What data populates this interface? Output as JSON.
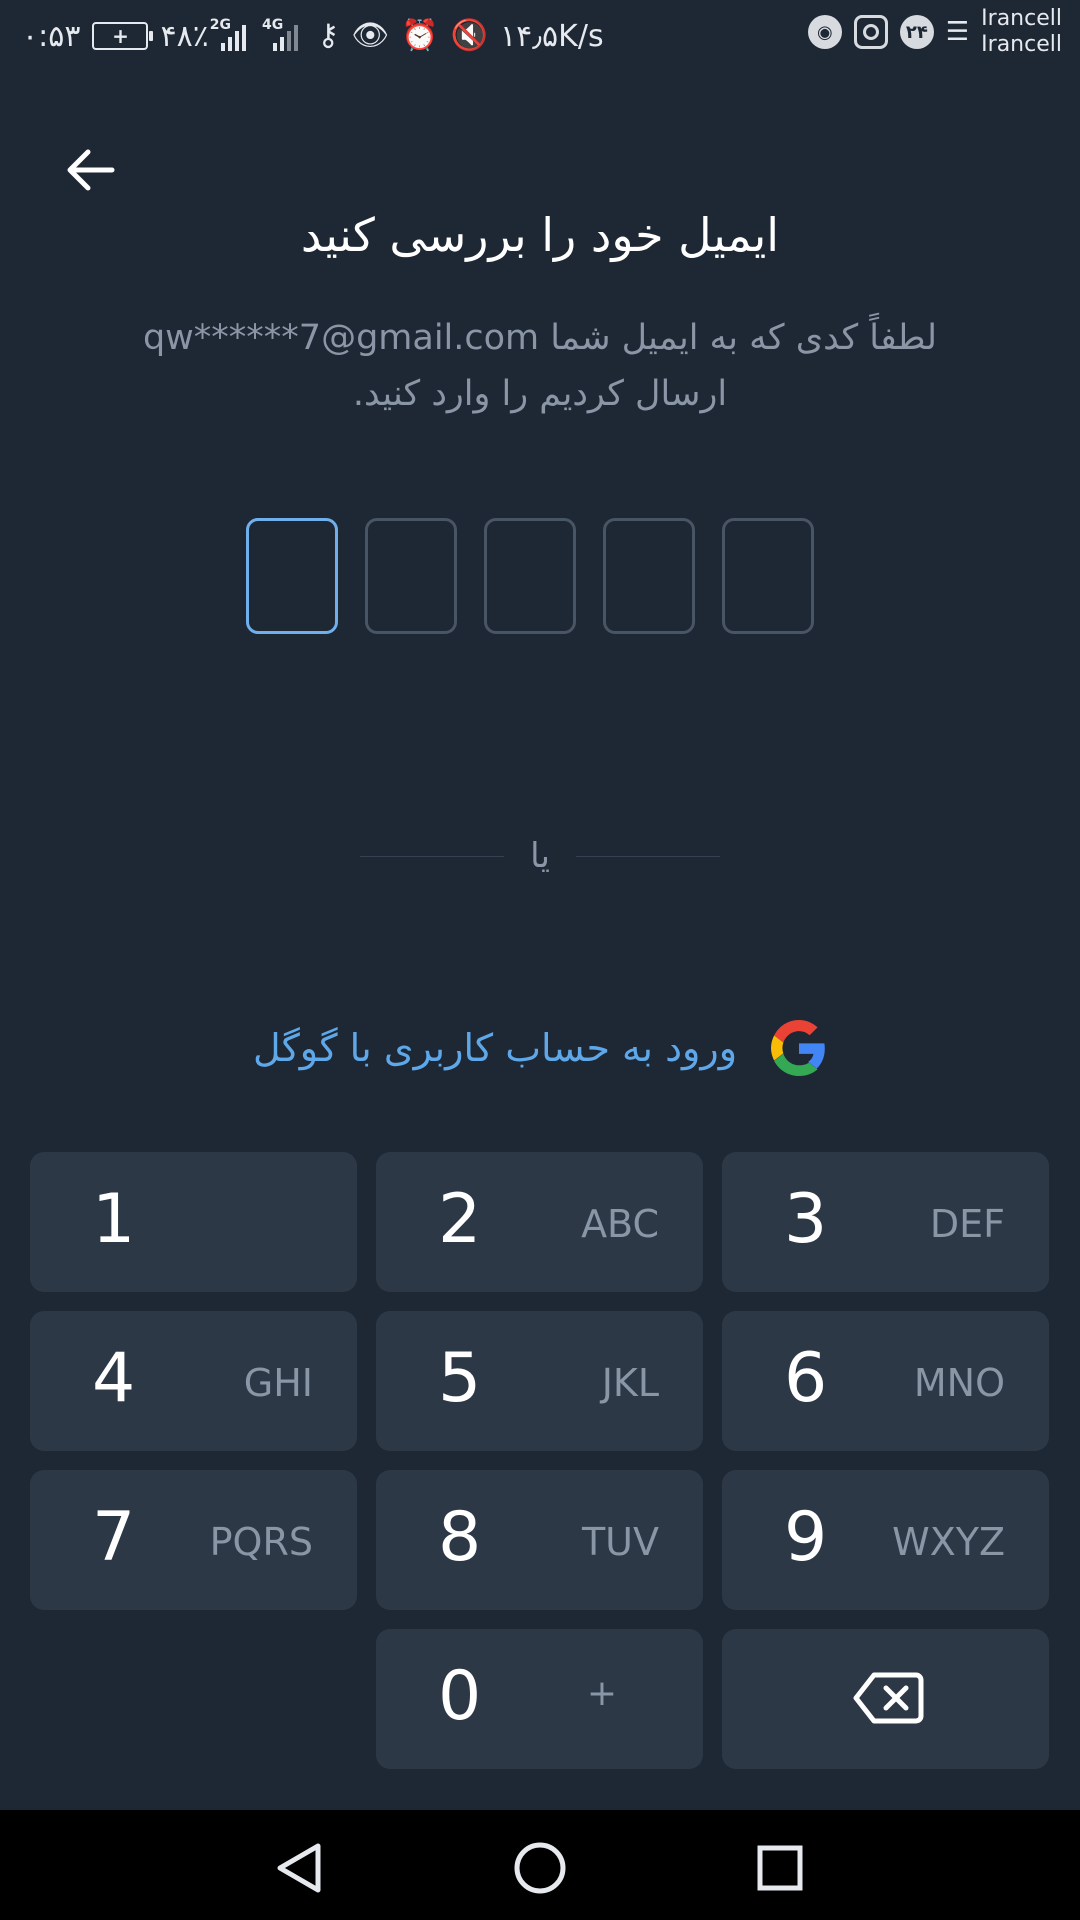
{
  "status_bar": {
    "time": "۰:۵۳",
    "battery": "۴۸٪",
    "net_2g": "2G",
    "net_4g": "4G",
    "speed": "۱۴٫۵K/s",
    "notif_count": "۲۴",
    "carrier_1": "Irancell",
    "carrier_2": "Irancell"
  },
  "header": {
    "title": "ایمیل خود را بررسی کنید",
    "subtitle_prefix": "لطفاً کدی که به ایمیل شما",
    "email": "qw******7@gmail.com",
    "subtitle_suffix": "ارسال کردیم را وارد کنید."
  },
  "code": {
    "length": 5,
    "active_index": 0,
    "values": [
      "",
      "",
      "",
      "",
      ""
    ]
  },
  "divider_text": "یا",
  "google": {
    "label": "ورود به حساب کاربری با گوگل",
    "icon": "google-g-icon"
  },
  "keypad": {
    "keys": [
      {
        "num": "1",
        "letters": ""
      },
      {
        "num": "2",
        "letters": "ABC"
      },
      {
        "num": "3",
        "letters": "DEF"
      },
      {
        "num": "4",
        "letters": "GHI"
      },
      {
        "num": "5",
        "letters": "JKL"
      },
      {
        "num": "6",
        "letters": "MNO"
      },
      {
        "num": "7",
        "letters": "PQRS"
      },
      {
        "num": "8",
        "letters": "TUV"
      },
      {
        "num": "9",
        "letters": "WXYZ"
      },
      {
        "num": "0",
        "letters": "+"
      }
    ],
    "delete_icon": "backspace-icon"
  },
  "colors": {
    "background": "#1e2734",
    "key_bg": "#2d3846",
    "accent": "#6fb0ec",
    "link": "#5ea8ea",
    "muted_text": "#8a96a6"
  }
}
